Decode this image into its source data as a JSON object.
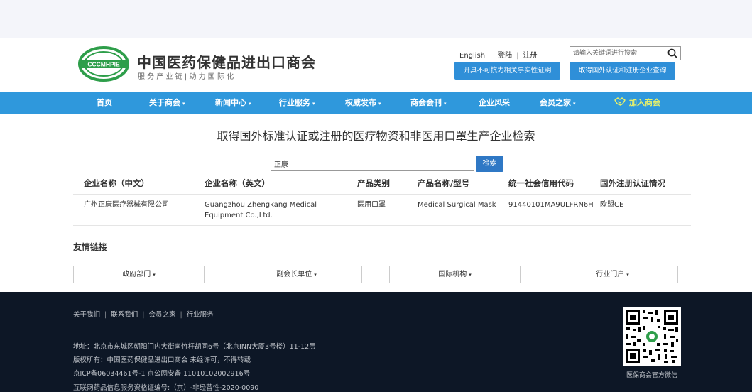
{
  "header": {
    "logo_text": "CCCMHPIE",
    "org_name": "中国医药保健品进出口商会",
    "slogan": "服  务  产  业  链   |   助  力  国  际  化",
    "links": {
      "english": "English",
      "login": "登陆",
      "register": "注册"
    },
    "search": {
      "placeholder": "请输入关键词进行搜索"
    },
    "btn_force_majeure": "开具不可抗力相关事实性证明",
    "btn_cert_query": "取得国外认证和注册企业查询"
  },
  "nav": {
    "items": [
      {
        "label": "首页",
        "dropdown": false
      },
      {
        "label": "关于商会",
        "dropdown": true
      },
      {
        "label": "新闻中心",
        "dropdown": true
      },
      {
        "label": "行业服务",
        "dropdown": true
      },
      {
        "label": "权威发布",
        "dropdown": true
      },
      {
        "label": "商会会刊",
        "dropdown": true
      },
      {
        "label": "企业风采",
        "dropdown": false
      },
      {
        "label": "会员之家",
        "dropdown": true
      }
    ],
    "join": "加入商会",
    "caret": "▾"
  },
  "main": {
    "title": "取得国外标准认证或注册的医疗物资和非医用口罩生产企业检索",
    "query_value": "正康",
    "query_button": "检索",
    "columns": [
      "企业名称（中文）",
      "企业名称（英文）",
      "产品类别",
      "产品名称/型号",
      "统一社会信用代码",
      "国外注册认证情况"
    ],
    "rows": [
      [
        "广州正康医疗器械有限公司",
        "Guangzhou Zhengkang Medical Equipment Co.,Ltd.",
        "医用口罩",
        "Medical Surgical Mask",
        "91440101MA9ULFRN6H",
        "欧盟CE"
      ]
    ]
  },
  "friends": {
    "title": "友情链接",
    "dropdowns": [
      "政府部门",
      "副会长单位",
      "国际机构",
      "行业门户"
    ]
  },
  "footer": {
    "links": [
      "关于我们",
      "联系我们",
      "会员之家",
      "行业服务"
    ],
    "address": "地址：北京市东城区朝阳门内大街南竹杆胡同6号（北京INN大厦3号楼）11-12层",
    "copyright": "版权所有：中国医药保健品进出口商会 未经许可，不得转载",
    "icp": "京ICP备06034461号-1 京公网安备 11010102002916号",
    "license": "互联网药品信息服务资格证编号:（京）-非经营性-2020-0090",
    "qr_caption": "医保商会官方微信"
  },
  "colors": {
    "nav": "#2f98dc",
    "button": "#2f8fd8",
    "footer": "#0d1726",
    "logo_green": "#2e9e4a"
  }
}
